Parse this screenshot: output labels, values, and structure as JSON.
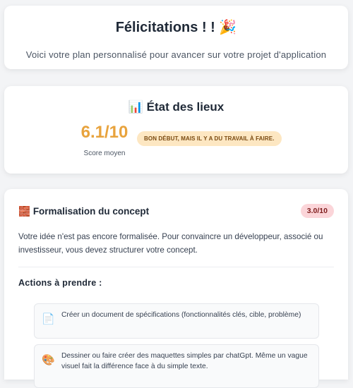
{
  "hero": {
    "title": "Félicitations ! ! 🎉",
    "subtitle": "Voici votre plan personnalisé pour avancer sur votre projet d'application"
  },
  "state": {
    "icon": "bar-chart-icon",
    "icon_glyph": "📊",
    "title": "État des lieux",
    "score_value": "6.1/10",
    "score_label": "Score moyen",
    "verdict": "BON DÉBUT, MAIS IL Y A DU TRAVAIL À FAIRE.",
    "score_color": "#e8a33d"
  },
  "concept": {
    "icon": "brick-icon",
    "icon_glyph": "🧱",
    "title": "Formalisation du concept",
    "score": "3.0/10",
    "description": "Votre idée n'est pas encore formalisée. Pour convaincre un développeur, associé ou investisseur, vous devez structurer votre concept.",
    "actions_title": "Actions à prendre :",
    "actions": [
      {
        "icon": "document-icon",
        "icon_glyph": "📄",
        "text": "Créer un document de spécifications (fonctionnalités clés, cible, problème)"
      },
      {
        "icon": "palette-icon",
        "icon_glyph": "🎨",
        "text": "Dessiner ou faire créer des maquettes simples par chatGpt. Même un vague visuel fait la différence face à du simple texte."
      }
    ]
  }
}
